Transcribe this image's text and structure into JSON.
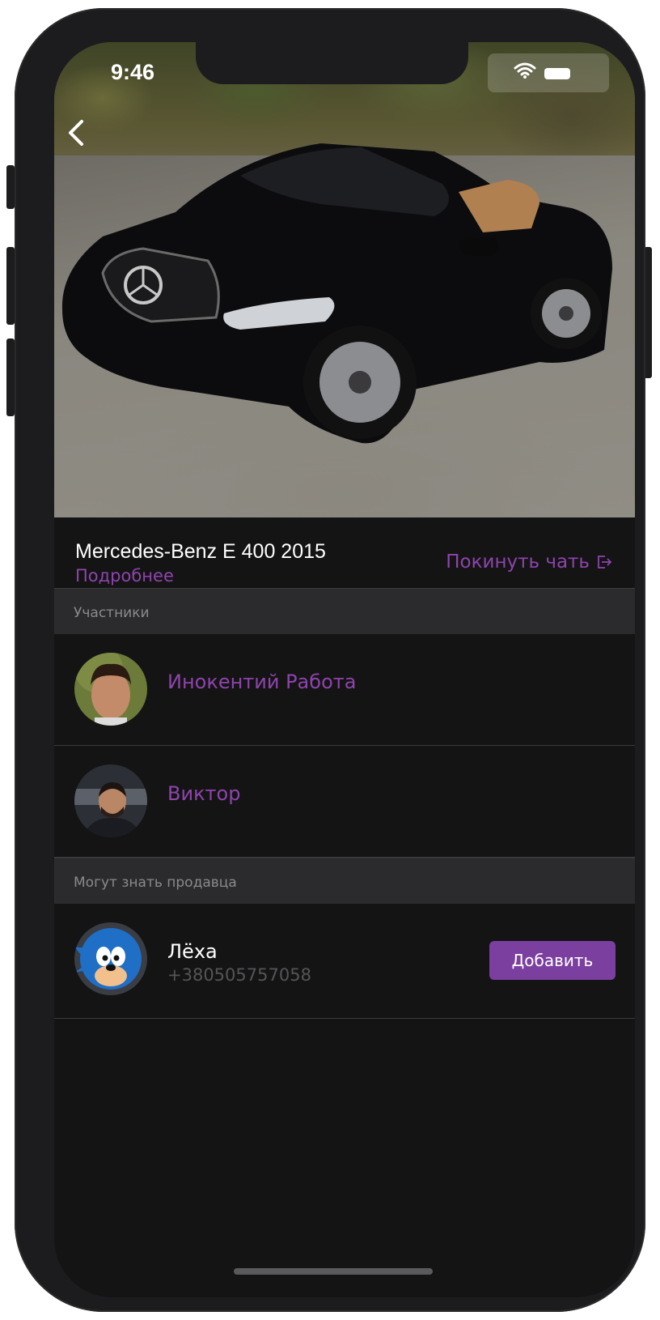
{
  "status_bar": {
    "time": "9:46",
    "wifi_icon": "wifi-icon",
    "battery_icon": "battery-icon"
  },
  "nav": {
    "back_icon": "chevron-left-icon"
  },
  "car": {
    "title": "Mercedes-Benz E 400 2015",
    "details_link": "Подробнее",
    "leave_chat_label": "Покинуть чать",
    "leave_icon": "exit-icon"
  },
  "participants": {
    "header": "Участники",
    "items": [
      {
        "name": "Инокентий Работа",
        "avatar": "avatar-photo"
      },
      {
        "name": "Виктор",
        "avatar": "avatar-photo"
      }
    ]
  },
  "may_know_seller": {
    "header": "Могут знать продавца",
    "items": [
      {
        "name": "Лёха",
        "phone": "+380505757058",
        "action_label": "Добавить",
        "avatar": "sonic-avatar"
      }
    ]
  },
  "colors": {
    "accent": "#8e44ad",
    "button": "#7b3fa0",
    "background": "#141414",
    "section": "#2b2b2d"
  }
}
